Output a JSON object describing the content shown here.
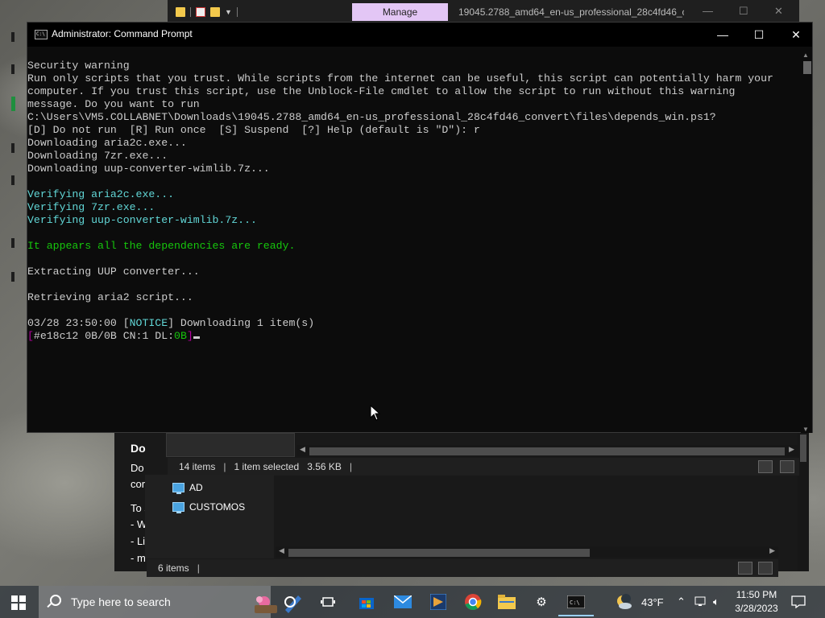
{
  "explorer": {
    "manage_tab": "Manage",
    "title": "19045.2788_amd64_en-us_professional_28c4fd46_c...",
    "status_upper": {
      "items": "14 items",
      "selected": "1 item selected",
      "size": "3.56 KB"
    },
    "status_lower": {
      "items": "6 items"
    },
    "nav_items": [
      {
        "label": "AD"
      },
      {
        "label": "CUSTOMOS"
      }
    ],
    "doc_snippets": [
      "Do",
      "Do",
      "cor",
      "To s",
      "- W",
      "- Li",
      "- m"
    ]
  },
  "cmd": {
    "title": "Administrator: Command Prompt",
    "lines": [
      {
        "text": "Security warning",
        "color": "default"
      },
      {
        "text": "Run only scripts that you trust. While scripts from the internet can be useful, this script can potentially harm your",
        "color": "default"
      },
      {
        "text": "computer. If you trust this script, use the Unblock-File cmdlet to allow the script to run without this warning",
        "color": "default"
      },
      {
        "text": "message. Do you want to run",
        "color": "default"
      },
      {
        "text": "C:\\Users\\VM5.COLLABNET\\Downloads\\19045.2788_amd64_en-us_professional_28c4fd46_convert\\files\\depends_win.ps1?",
        "color": "default"
      },
      {
        "text": "[D] Do not run  [R] Run once  [S] Suspend  [?] Help (default is \"D\"): r",
        "color": "default"
      },
      {
        "text": "Downloading aria2c.exe...",
        "color": "default"
      },
      {
        "text": "Downloading 7zr.exe...",
        "color": "default"
      },
      {
        "text": "Downloading uup-converter-wimlib.7z...",
        "color": "default"
      },
      {
        "text": "",
        "color": "default"
      },
      {
        "text": "Verifying aria2c.exe...",
        "color": "cyan"
      },
      {
        "text": "Verifying 7zr.exe...",
        "color": "cyan"
      },
      {
        "text": "Verifying uup-converter-wimlib.7z...",
        "color": "cyan"
      },
      {
        "text": "",
        "color": "default"
      },
      {
        "text": "It appears all the dependencies are ready.",
        "color": "green"
      },
      {
        "text": "",
        "color": "default"
      },
      {
        "text": "Extracting UUP converter...",
        "color": "default"
      },
      {
        "text": "",
        "color": "default"
      },
      {
        "text": "Retrieving aria2 script...",
        "color": "default"
      },
      {
        "text": "",
        "color": "default"
      }
    ],
    "notice_line": {
      "time": "03/28 23:50:00 [",
      "tag": "NOTICE",
      "rest": "] Downloading 1 item(s)"
    },
    "progress_line": {
      "open": "[",
      "gid": "#e18c12 0B/0B CN:1 DL:",
      "dl": "0B",
      "close": "]"
    }
  },
  "taskbar": {
    "search_placeholder": "Type here to search",
    "weather": "43°F",
    "time": "11:50 PM",
    "date": "3/28/2023"
  },
  "colors": {
    "console_bg": "#0c0c0c",
    "console_text": "#cccccc",
    "cyan": "#61d6d6",
    "green": "#16c60c",
    "magenta": "#b4009e",
    "manage_tab": "#e3c6f5"
  }
}
